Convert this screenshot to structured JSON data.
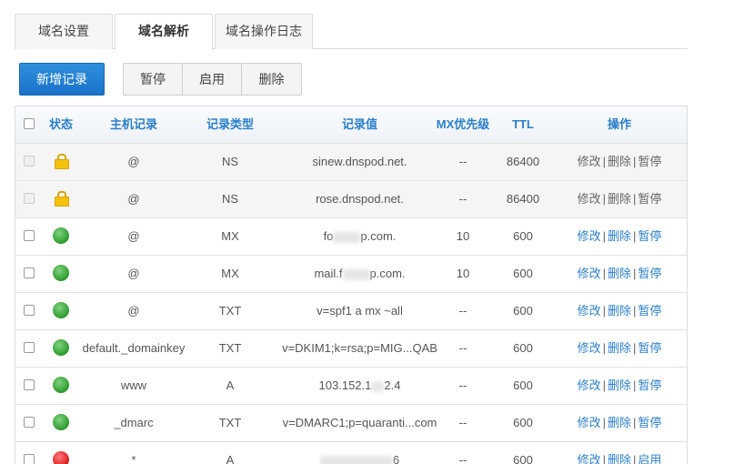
{
  "tabs": [
    {
      "label": "域名设置",
      "active": false
    },
    {
      "label": "域名解析",
      "active": true
    },
    {
      "label": "域名操作日志",
      "active": false
    }
  ],
  "toolbar": {
    "add_label": "新增记录",
    "pause_label": "暂停",
    "enable_label": "启用",
    "delete_label": "删除"
  },
  "table": {
    "headers": {
      "status": "状态",
      "host": "主机记录",
      "type": "记录类型",
      "value": "记录值",
      "mx": "MX优先级",
      "ttl": "TTL",
      "ops": "操作"
    },
    "rows": [
      {
        "status": "locked",
        "host": "@",
        "type": "NS",
        "value": "sinew.dnspod.net.",
        "mx": "--",
        "ttl": "86400",
        "ops": [
          "修改",
          "删除",
          "暂停"
        ]
      },
      {
        "status": "locked",
        "host": "@",
        "type": "NS",
        "value": "rose.dnspod.net.",
        "mx": "--",
        "ttl": "86400",
        "ops": [
          "修改",
          "删除",
          "暂停"
        ]
      },
      {
        "status": "enabled",
        "host": "@",
        "type": "MX",
        "value_pre": "fo",
        "value_post": "p.com.",
        "mx": "10",
        "ttl": "600",
        "ops": [
          "修改",
          "删除",
          "暂停"
        ]
      },
      {
        "status": "enabled",
        "host": "@",
        "type": "MX",
        "value_pre": "mail.f",
        "value_post": "p.com.",
        "mx": "10",
        "ttl": "600",
        "ops": [
          "修改",
          "删除",
          "暂停"
        ]
      },
      {
        "status": "enabled",
        "host": "@",
        "type": "TXT",
        "value": "v=spf1 a mx ~all",
        "mx": "--",
        "ttl": "600",
        "ops": [
          "修改",
          "删除",
          "暂停"
        ]
      },
      {
        "status": "enabled",
        "host": "default._domainkey",
        "type": "TXT",
        "value": "v=DKIM1;k=rsa;p=MIG...QAB",
        "mx": "--",
        "ttl": "600",
        "ops": [
          "修改",
          "删除",
          "暂停"
        ]
      },
      {
        "status": "enabled",
        "host": "www",
        "type": "A",
        "value_pre": "103.152.1",
        "value_post": "2.4",
        "mx": "--",
        "ttl": "600",
        "ops": [
          "修改",
          "删除",
          "暂停"
        ]
      },
      {
        "status": "enabled",
        "host": "_dmarc",
        "type": "TXT",
        "value": "v=DMARC1;p=quaranti...com",
        "mx": "--",
        "ttl": "600",
        "ops": [
          "修改",
          "删除",
          "暂停"
        ]
      },
      {
        "status": "paused",
        "host": "*",
        "type": "A",
        "value_pre": "",
        "value_post": "6",
        "mx": "--",
        "ttl": "600",
        "ops": [
          "修改",
          "删除",
          "启用"
        ]
      }
    ]
  }
}
